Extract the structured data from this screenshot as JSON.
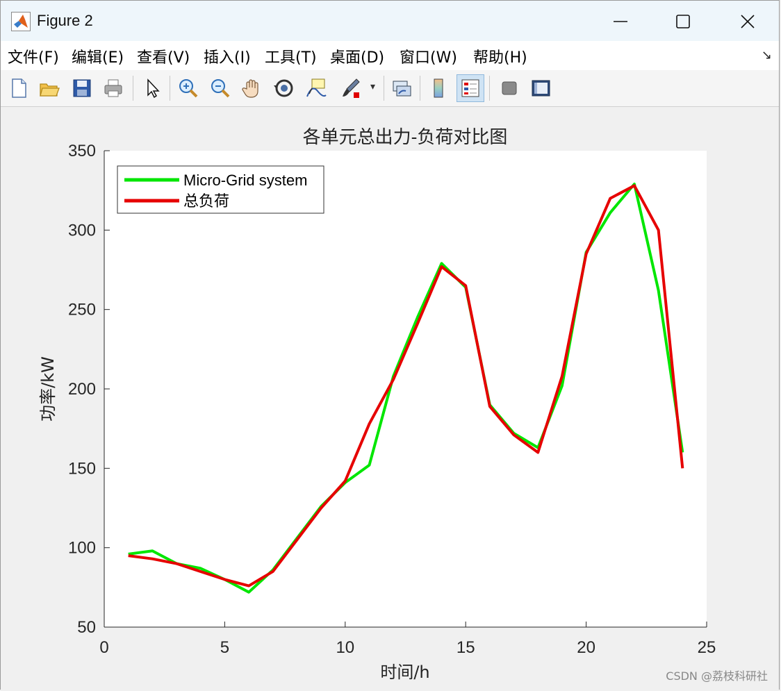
{
  "window": {
    "title": "Figure 2",
    "icon": "matlab-icon",
    "controls": [
      "minimize-icon",
      "maximize-icon",
      "close-icon"
    ]
  },
  "menu": {
    "items": [
      "文件(F)",
      "编辑(E)",
      "查看(V)",
      "插入(I)",
      "工具(T)",
      "桌面(D)",
      "窗口(W)",
      "帮助(H)"
    ],
    "dock_arrow": "↘"
  },
  "toolbar": {
    "icons": [
      "new-figure-icon",
      "open-file-icon",
      "save-icon",
      "print-icon",
      "pointer-icon",
      "zoom-in-icon",
      "zoom-out-icon",
      "pan-icon",
      "rotate-3d-icon",
      "data-cursor-icon",
      "brush-icon",
      "link-plot-icon",
      "colorbar-icon",
      "legend-icon",
      "hide-plot-tools-icon",
      "show-plot-tools-icon"
    ]
  },
  "watermark": "CSDN @荔枝科研社",
  "colors": {
    "green": "#00e600",
    "red": "#e60000"
  },
  "chart_data": {
    "type": "line",
    "title": "各单元总出力-负荷对比图",
    "xlabel": "时间/h",
    "ylabel": "功率/kW",
    "xlim": [
      0,
      25
    ],
    "ylim": [
      50,
      350
    ],
    "xticks": [
      0,
      5,
      10,
      15,
      20,
      25
    ],
    "yticks": [
      50,
      100,
      150,
      200,
      250,
      300,
      350
    ],
    "legend_position": "top-left",
    "grid": false,
    "x": [
      1,
      2,
      3,
      4,
      5,
      6,
      7,
      8,
      9,
      10,
      11,
      12,
      13,
      14,
      15,
      16,
      17,
      18,
      19,
      20,
      21,
      22,
      23,
      24
    ],
    "series": [
      {
        "name": "Micro-Grid system",
        "color": "#00e600",
        "values": [
          96,
          98,
          90,
          87,
          80,
          72,
          86,
          106,
          126,
          141,
          152,
          208,
          245,
          279,
          264,
          190,
          172,
          163,
          202,
          286,
          311,
          329,
          262,
          160
        ]
      },
      {
        "name": "总负荷",
        "color": "#e60000",
        "values": [
          95,
          93,
          90,
          85,
          80,
          76,
          85,
          105,
          125,
          142,
          178,
          206,
          241,
          277,
          265,
          189,
          171,
          160,
          208,
          285,
          320,
          328,
          300,
          150
        ]
      }
    ]
  }
}
